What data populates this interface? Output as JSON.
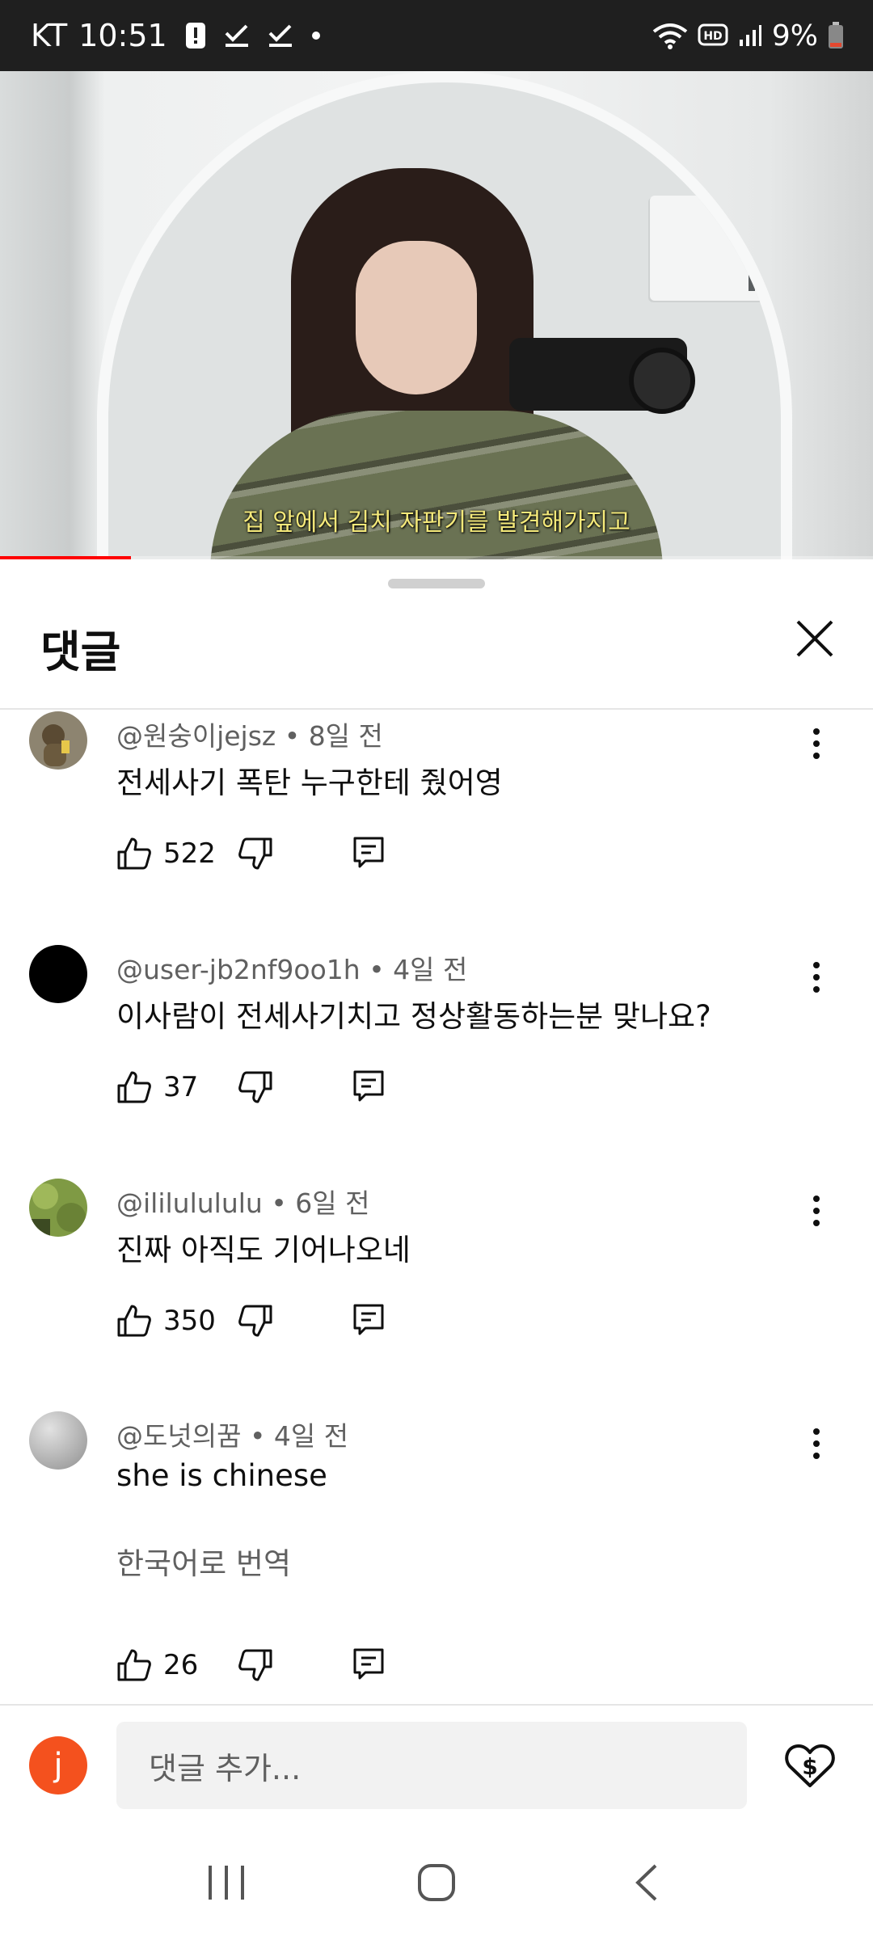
{
  "status_bar": {
    "carrier": "KT",
    "time": "10:51",
    "hd": "HD",
    "battery": "9%"
  },
  "video": {
    "subtitle": "집 앞에서 김치 자판기를 발견해가지고",
    "progress": 0.15
  },
  "sheet": {
    "title": "댓글"
  },
  "comments": [
    {
      "author": "@원숭이jejsz",
      "age": "8일 전",
      "text": "전세사기 폭탄 누구한테 줬어영",
      "likes": "522",
      "avatar_color": "#6b5a3e"
    },
    {
      "author": "@user-jb2nf9oo1h",
      "age": "4일 전",
      "text": "이사람이 전세사기치고 정상활동하는분 맞나요?",
      "likes": "37",
      "avatar_color": "#000000"
    },
    {
      "author": "@ililulululu",
      "age": "6일 전",
      "text": "진짜 아직도 기어나오네",
      "likes": "350",
      "avatar_color": "#7f9a44"
    },
    {
      "author": "@도넛의꿈",
      "age": "4일 전",
      "text": "she is chinese",
      "translate": "한국어로 번역",
      "likes": "26",
      "avatar_color": "#b5b5b5"
    }
  ],
  "input": {
    "avatar_letter": "j",
    "placeholder": "댓글 추가..."
  },
  "colors": {
    "accent_red": "#ff0000",
    "my_avatar": "#f4511e",
    "meta_gray": "#606060"
  }
}
